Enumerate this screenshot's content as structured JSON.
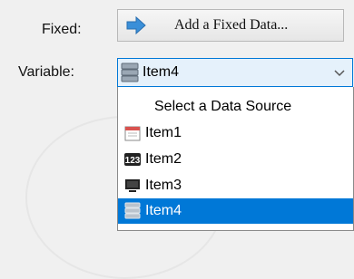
{
  "labels": {
    "fixed": "Fixed:",
    "variable": "Variable:"
  },
  "fixed_button": {
    "label": "Add a Fixed Data...",
    "icon": "arrow-icon"
  },
  "combo": {
    "value": "Item4",
    "icon": "database-icon"
  },
  "dropdown": {
    "header": "Select a Data Source",
    "items": [
      {
        "label": "Item1",
        "icon": "calendar-icon"
      },
      {
        "label": "Item2",
        "icon": "number-123-icon"
      },
      {
        "label": "Item3",
        "icon": "monitor-icon"
      },
      {
        "label": "Item4",
        "icon": "database-icon",
        "selected": true
      }
    ]
  },
  "colors": {
    "selection": "#0078d7",
    "combo_bg": "#e5f1fb",
    "arrow": "#3a8fd8"
  }
}
